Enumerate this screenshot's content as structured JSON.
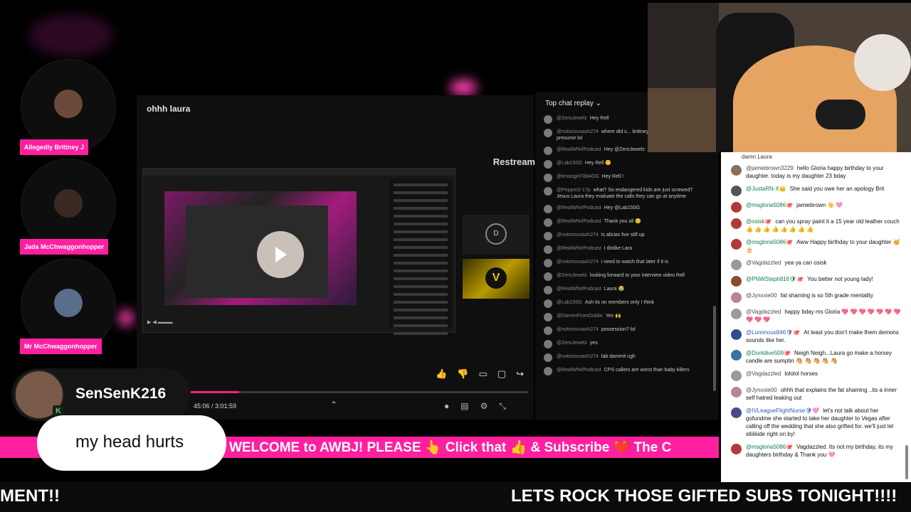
{
  "hosts": [
    {
      "name": "Allegedly Brittney J"
    },
    {
      "name": "Jada McChwaggonhopper"
    },
    {
      "name": "Mr McChwaggonhopper"
    }
  ],
  "player": {
    "title": "ohhh laura",
    "watermark": "Restream",
    "time": "45:06 / 3:01:59",
    "progress_fraction": 0.25,
    "tile_d": "D",
    "tile_v": "V"
  },
  "replay_chat": {
    "header": "Top chat replay",
    "messages": [
      {
        "user": "@ZeroJewelz",
        "text": "Hey Rell"
      },
      {
        "user": "@notoriousash274",
        "text": "where did s... brittneys call happened at 9 pre... presume lol"
      },
      {
        "user": "@RealWhirlPodcast",
        "text": "Hey @ZeroJewelz"
      },
      {
        "user": "@Lab150G",
        "text": "Hey Rell 😊"
      },
      {
        "user": "@texasgirl7884OG",
        "text": "Hey Rell !"
      },
      {
        "user": "@Pepper2-17p",
        "text": "what? So endangered kids are just screwed? Jesus Laura they evaluate the calls they can go at anytime"
      },
      {
        "user": "@RealWhirlPodcast",
        "text": "Hey @Lab150G"
      },
      {
        "user": "@RealWhirlPodcast",
        "text": "Thank you all 😊"
      },
      {
        "user": "@notoriousash274",
        "text": "is alicias live still up"
      },
      {
        "user": "@RealWhirlPodcast",
        "text": "I dislike Lara"
      },
      {
        "user": "@notoriousash274",
        "text": "i need to watch that later if it is"
      },
      {
        "user": "@ZeroJewelz",
        "text": "looking forward to your interview video Rell"
      },
      {
        "user": "@RealWhirlPodcast",
        "text": "Laura 😂"
      },
      {
        "user": "@Lab150G",
        "text": "Ash its on members only I think"
      },
      {
        "user": "@DarrenFromDublin",
        "text": "Yes 🙌"
      },
      {
        "user": "@notoriousash274",
        "text": "possession? lol"
      },
      {
        "user": "@ZeroJewelz",
        "text": "yes"
      },
      {
        "user": "@notoriousash274",
        "text": "lab dammit ugh"
      },
      {
        "user": "@RealWhirlPodcast",
        "text": "CPS callers are worst than baby killers"
      }
    ]
  },
  "live_chat": {
    "top_line": "damn Laura",
    "messages": [
      {
        "user": "@jamiebrown3229",
        "kind": "plain",
        "text": "hello Gloria happy birthday to your daughter. today is my daughter 23 bday",
        "color": "#8a6f5a"
      },
      {
        "user": "@JustaRN-X👑",
        "kind": "mem",
        "text": "She said you owe her an apology Brit",
        "color": "#555555"
      },
      {
        "user": "@msgloria5086🐙",
        "kind": "mem",
        "text": "jamiebrown 👋 🩷",
        "color": "#b03a3a"
      },
      {
        "user": "@osisk🐙",
        "kind": "mem",
        "text": "can you spray paint it a 15 year old leather couch 👍 👍 👍 👍 👍 👍 👍 👍",
        "color": "#b03a3a"
      },
      {
        "user": "@msgloria5086🐙",
        "kind": "mem",
        "text": "Aww Happy birthday to your daughter 🥳 🎂",
        "color": "#b03a3a"
      },
      {
        "user": "@Vagdazzled",
        "kind": "plain",
        "text": "yea ya can osisk",
        "color": "#9a9a9a"
      },
      {
        "user": "@PNWSteph816🛡🐙",
        "kind": "mem",
        "text": "You better not young lady!",
        "color": "#8c4b2b"
      },
      {
        "user": "@Jynxxie00",
        "kind": "plain",
        "text": "fat shaming is so 5th grade mentality",
        "color": "#b8868f"
      },
      {
        "user": "@Vagdazzled",
        "kind": "plain",
        "text": "happy bday ms Gloria 💖 💖 💖 💖 💖 💖 💖 💖 💖 💖",
        "color": "#9a9a9a"
      },
      {
        "user": "@Luminous846🛡🐙",
        "kind": "mod",
        "text": "At least you don't make them demons sounds like her.",
        "color": "#2e4f8c"
      },
      {
        "user": "@Dontdive509🐙",
        "kind": "mem",
        "text": "Neigh Neigh...Laura go make a horsey candle are sumptin 🐴 🐴 🐴 🐴 🐴",
        "color": "#3d6fa3"
      },
      {
        "user": "@Vagdazzled",
        "kind": "plain",
        "text": "lololol horses",
        "color": "#9a9a9a"
      },
      {
        "user": "@Jynxxie00",
        "kind": "plain",
        "text": "ohhh that explains the fat shaming ..its a inner self hatred leaking out",
        "color": "#b8868f"
      },
      {
        "user": "@IVLeagueFlightNurse🛡🩷",
        "kind": "mod",
        "text": "let's not talk about her gofundme she started to take her daughter to Vegas after calling off the wedding that she also grifted for. we'll just let sliiiiiiide right on by!",
        "color": "#4a4a8a"
      },
      {
        "user": "@msgloria5086🐙",
        "kind": "mem",
        "text": "Vagdazzled. Its not my birthday, its my daughters birthday & Thank you 🩷",
        "color": "#b03a3a"
      }
    ]
  },
  "ticker": {
    "text": "WELCOME to AWBJ! PLEASE 👆 Click that 👍 & Subscribe ❤️ The C"
  },
  "banner": {
    "left_text": "MENT!!",
    "right_text": "LETS ROCK THOSE GIFTED SUBS TONIGHT!!!!"
  },
  "alert": {
    "username": "SenSenK216",
    "badge": "K",
    "message": "my head hurts"
  },
  "colors": {
    "accent_pink": "#ff1f9f",
    "background": "#000000"
  }
}
